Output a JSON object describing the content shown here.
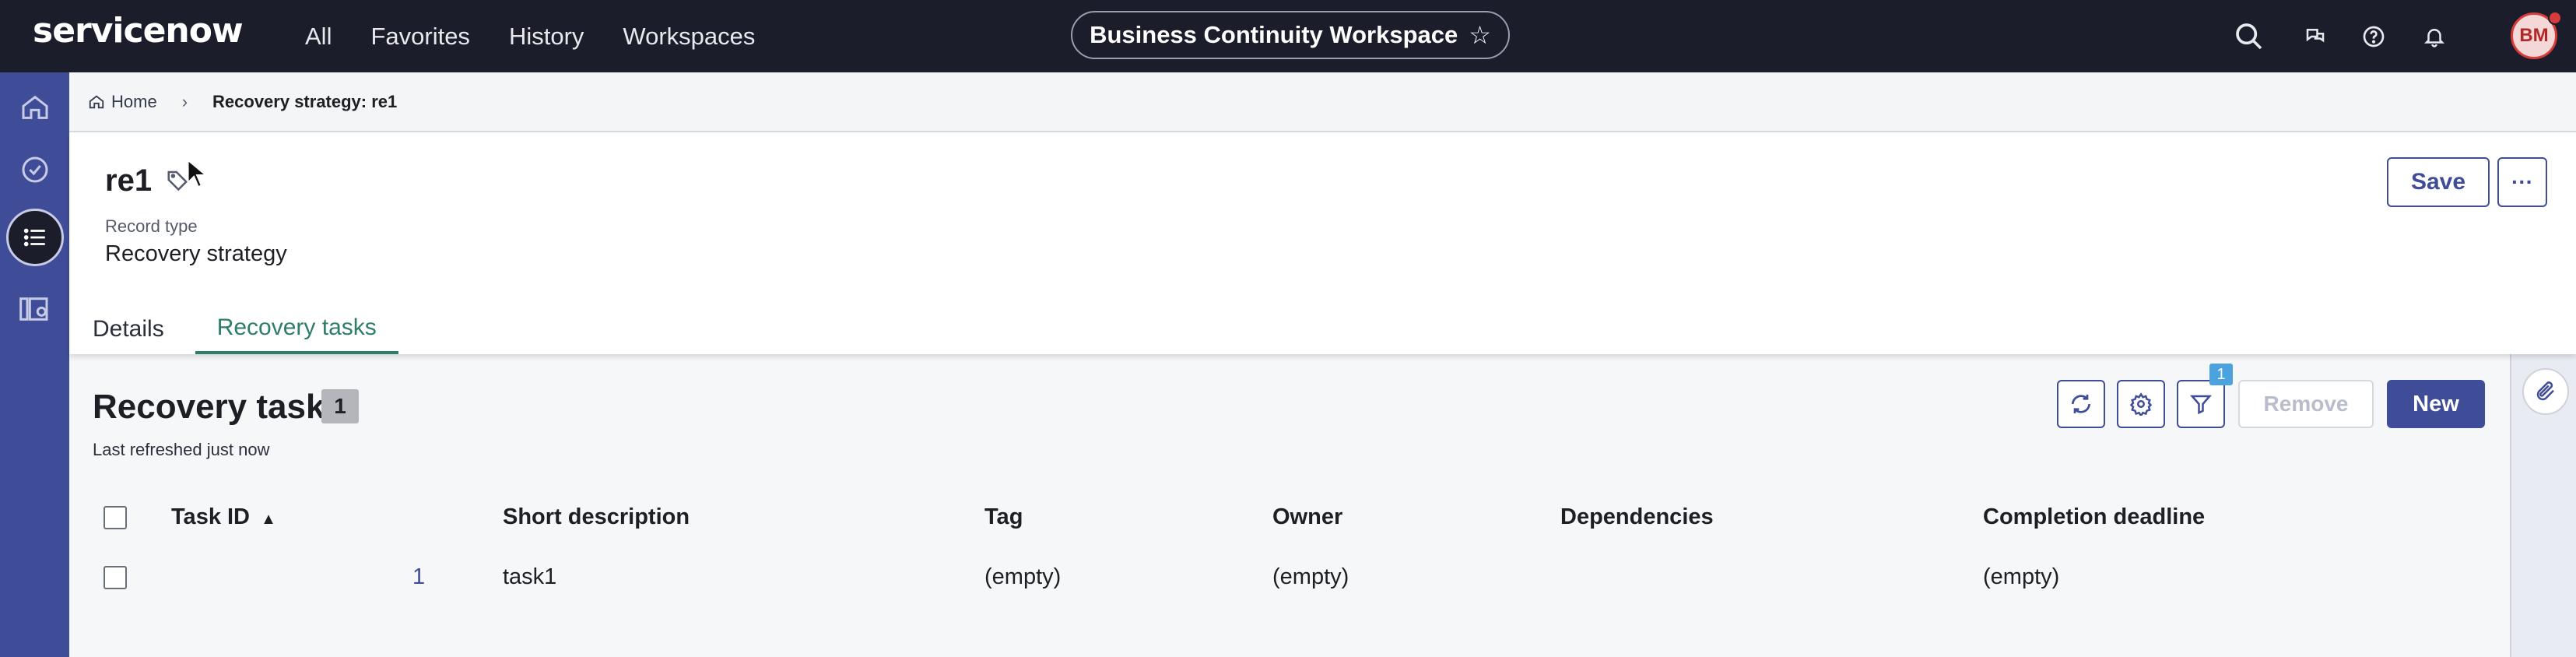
{
  "header": {
    "logo": "servicenow",
    "nav": [
      "All",
      "Favorites",
      "History",
      "Workspaces"
    ],
    "workspace": "Business Continuity Workspace",
    "avatar_initials": "BM"
  },
  "breadcrumb": {
    "home": "Home",
    "current": "Recovery strategy: re1"
  },
  "record": {
    "title": "re1",
    "type_label": "Record type",
    "type_value": "Recovery strategy",
    "save_label": "Save",
    "more_label": "···"
  },
  "tabs": [
    "Details",
    "Recovery tasks"
  ],
  "list": {
    "title": "Recovery task",
    "count": "1",
    "refreshed": "Last refreshed just now",
    "filter_count": "1",
    "remove_label": "Remove",
    "new_label": "New",
    "columns": [
      "Task ID",
      "Short description",
      "Tag",
      "Owner",
      "Dependencies",
      "Completion deadline"
    ],
    "sort_indicator": "▲",
    "rows": [
      {
        "task_id": "1",
        "short_description": "task1",
        "tag": "(empty)",
        "owner": "(empty)",
        "dependencies": "",
        "completion_deadline": "(empty)"
      }
    ]
  },
  "colors": {
    "header_bg": "#1b1d2b",
    "rail_bg": "#3f4c98",
    "accent": "#3f4c98",
    "tab_active": "#2e7d6a"
  }
}
